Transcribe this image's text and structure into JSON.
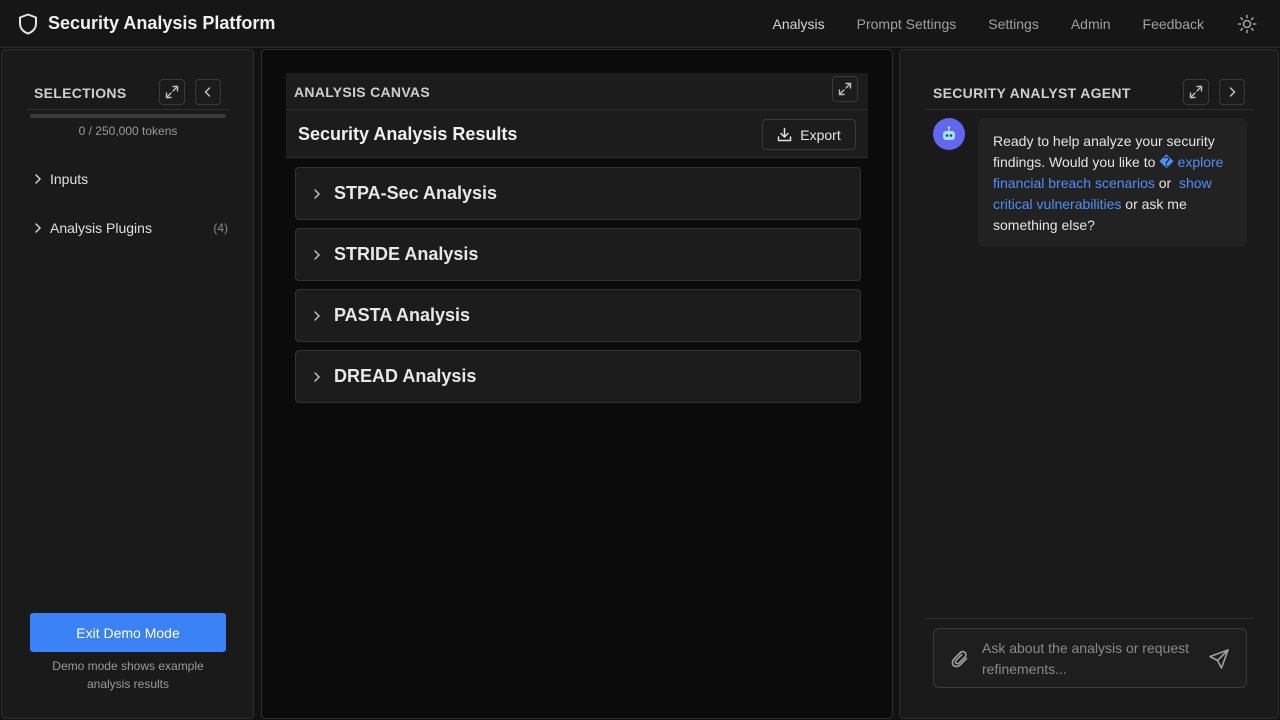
{
  "app": {
    "title": "Security Analysis Platform"
  },
  "nav": {
    "items": [
      "Analysis",
      "Prompt Settings",
      "Settings",
      "Admin",
      "Feedback"
    ],
    "active": "Analysis"
  },
  "selections": {
    "title": "SELECTIONS",
    "tokens": "0 / 250,000 tokens",
    "token_fill": 0,
    "items": [
      {
        "label": "Inputs",
        "count": ""
      },
      {
        "label": "Analysis Plugins",
        "count": "(4)"
      }
    ],
    "demo_button": "Exit Demo Mode",
    "demo_note": "Demo mode shows example analysis results"
  },
  "canvas": {
    "title": "ANALYSIS CANVAS",
    "results_title": "Security Analysis Results",
    "export_label": "Export",
    "analyses": [
      "STPA-Sec Analysis",
      "STRIDE Analysis",
      "PASTA Analysis",
      "DREAD Analysis"
    ]
  },
  "agent": {
    "title": "SECURITY ANALYST AGENT",
    "message_intro": "Ready to help analyze your security findings. Would you like to",
    "glyph": "�",
    "link_1": "explore financial breach scenarios",
    "connector": "or",
    "link_2": "show critical vulnerabilities",
    "message_outro": "or ask me something else?",
    "input_placeholder": "Ask about the analysis or request refinements..."
  },
  "colors": {
    "accent": "#3b82f6",
    "link": "#4f8ff7",
    "avatar": "#6366f1"
  }
}
